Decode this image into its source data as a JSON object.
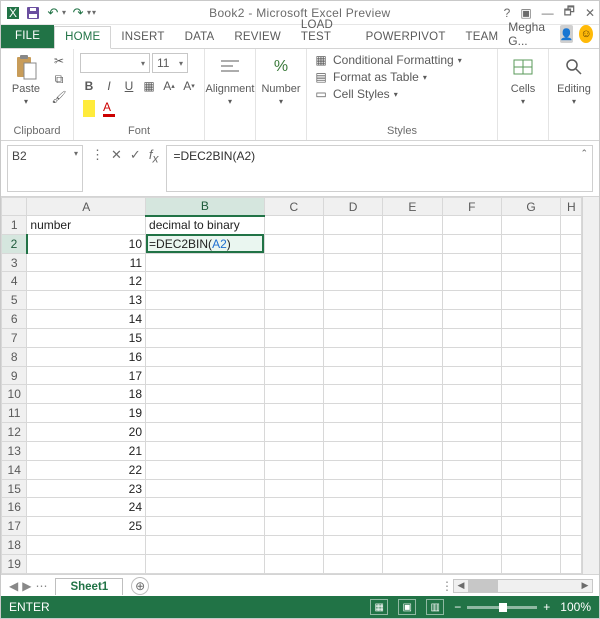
{
  "title": "Book2 - Microsoft Excel Preview",
  "user_label": "Megha G...",
  "tabs": {
    "file": "FILE",
    "home": "HOME",
    "insert": "INSERT",
    "data": "DATA",
    "review": "REVIEW",
    "loadtest": "LOAD TEST",
    "powerpivot": "POWERPIVOT",
    "team": "TEAM"
  },
  "ribbon": {
    "clipboard": {
      "paste": "Paste",
      "label": "Clipboard"
    },
    "font": {
      "name": "",
      "size": "11",
      "label": "Font"
    },
    "alignment": {
      "btn": "Alignment",
      "label": ""
    },
    "number": {
      "btn": "Number",
      "label": ""
    },
    "styles": {
      "cond": "Conditional Formatting",
      "table": "Format as Table",
      "cell": "Cell Styles",
      "label": "Styles"
    },
    "cells": {
      "btn": "Cells",
      "label": ""
    },
    "editing": {
      "btn": "Editing",
      "label": ""
    }
  },
  "name_box": "B2",
  "formula": "=DEC2BIN(A2)",
  "cell_edit_prefix": "=DEC2BIN(",
  "cell_edit_ref": "A2",
  "cell_edit_suffix": ")",
  "columns": [
    "A",
    "B",
    "C",
    "D",
    "E",
    "F",
    "G",
    "H"
  ],
  "rows": [
    {
      "n": "1",
      "a": "number",
      "b": "decimal to binary"
    },
    {
      "n": "2",
      "a": "10",
      "b_editing": true
    },
    {
      "n": "3",
      "a": "11"
    },
    {
      "n": "4",
      "a": "12"
    },
    {
      "n": "5",
      "a": "13"
    },
    {
      "n": "6",
      "a": "14"
    },
    {
      "n": "7",
      "a": "15"
    },
    {
      "n": "8",
      "a": "16"
    },
    {
      "n": "9",
      "a": "17"
    },
    {
      "n": "10",
      "a": "18"
    },
    {
      "n": "11",
      "a": "19"
    },
    {
      "n": "12",
      "a": "20"
    },
    {
      "n": "13",
      "a": "21"
    },
    {
      "n": "14",
      "a": "22"
    },
    {
      "n": "15",
      "a": "23"
    },
    {
      "n": "16",
      "a": "24"
    },
    {
      "n": "17",
      "a": "25"
    },
    {
      "n": "18",
      "a": ""
    },
    {
      "n": "19",
      "a": ""
    }
  ],
  "sheet_tab": "Sheet1",
  "status_mode": "ENTER",
  "zoom": "100%"
}
